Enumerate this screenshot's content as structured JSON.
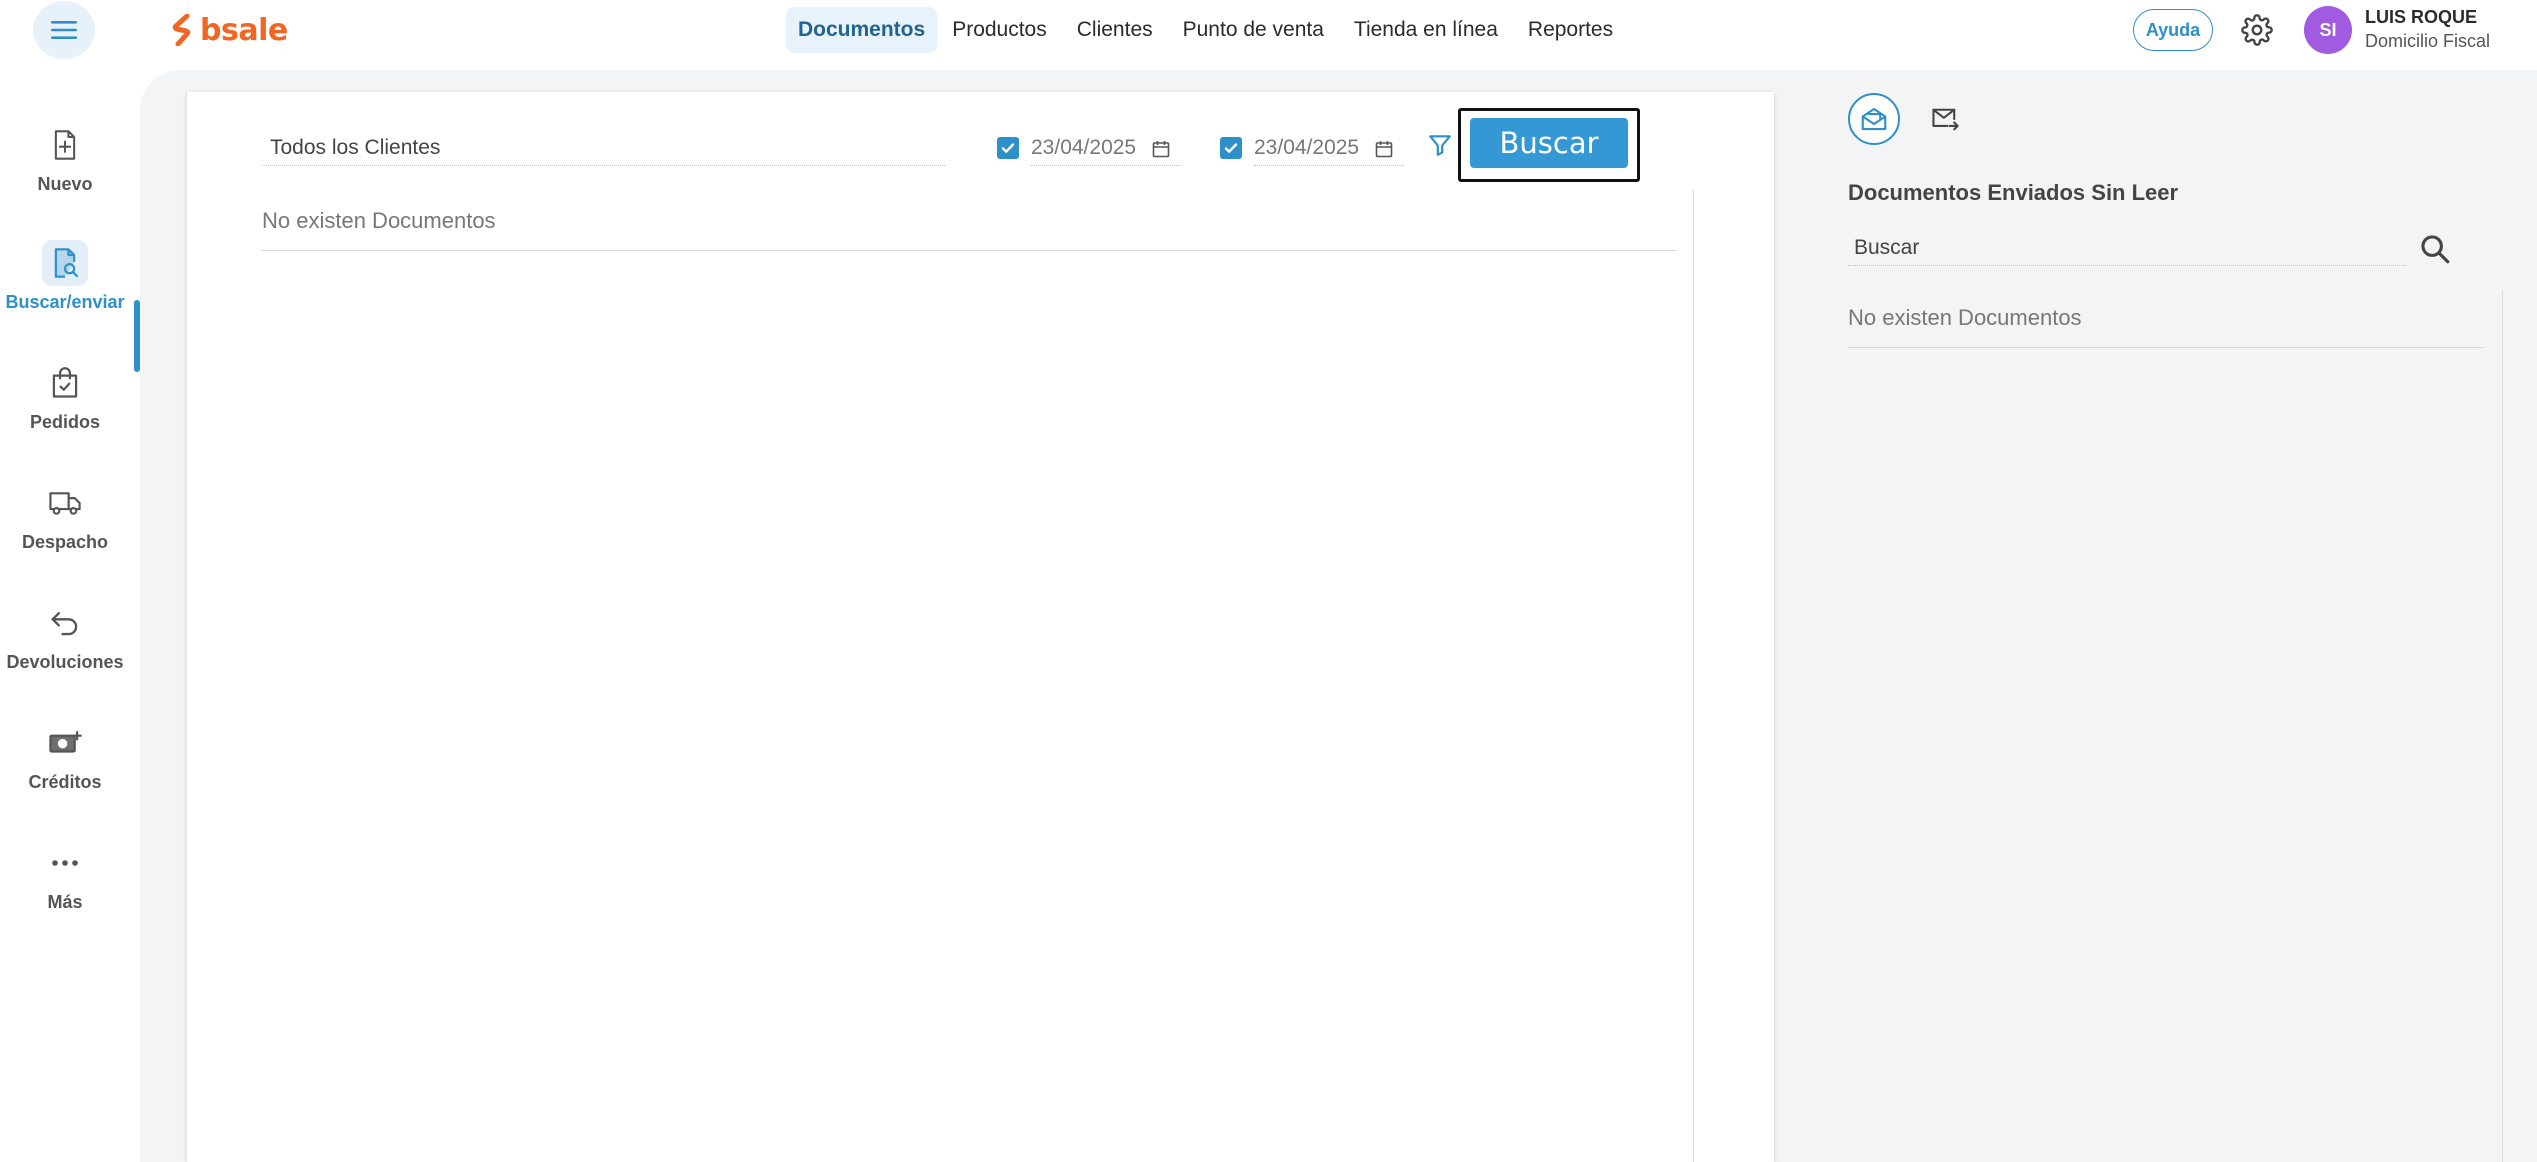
{
  "app": {
    "logo_text": "bsale",
    "brand_color": "#f26522",
    "accent_color": "#2f8fc9"
  },
  "header": {
    "nav": [
      {
        "label": "Documentos",
        "active": true
      },
      {
        "label": "Productos",
        "active": false
      },
      {
        "label": "Clientes",
        "active": false
      },
      {
        "label": "Punto de venta",
        "active": false
      },
      {
        "label": "Tienda en línea",
        "active": false
      },
      {
        "label": "Reportes",
        "active": false
      }
    ],
    "help_label": "Ayuda",
    "user": {
      "initials": "SI",
      "name": "LUIS ROQUE",
      "subtitle": "Domicilio Fiscal",
      "avatar_color": "#a05be0"
    }
  },
  "sidebar": {
    "items": [
      {
        "label": "Nuevo",
        "icon": "new-document-icon",
        "active": false
      },
      {
        "label": "Buscar/enviar",
        "icon": "search-document-icon",
        "active": true
      },
      {
        "label": "Pedidos",
        "icon": "shopping-bag-icon",
        "active": false
      },
      {
        "label": "Despacho",
        "icon": "truck-icon",
        "active": false
      },
      {
        "label": "Devoluciones",
        "icon": "return-arrow-icon",
        "active": false
      },
      {
        "label": "Créditos",
        "icon": "cash-icon",
        "active": false
      },
      {
        "label": "Más",
        "icon": "more-dots-icon",
        "active": false
      }
    ]
  },
  "search_form": {
    "client_value": "Todos los Clientes",
    "date_from": {
      "checked": true,
      "value": "23/04/2025"
    },
    "date_to": {
      "checked": true,
      "value": "23/04/2025"
    },
    "search_button": "Buscar",
    "empty_message": "No existen Documentos"
  },
  "right_panel": {
    "title": "Documentos Enviados Sin Leer",
    "search_placeholder": "Buscar",
    "empty_message": "No existen Documentos"
  }
}
